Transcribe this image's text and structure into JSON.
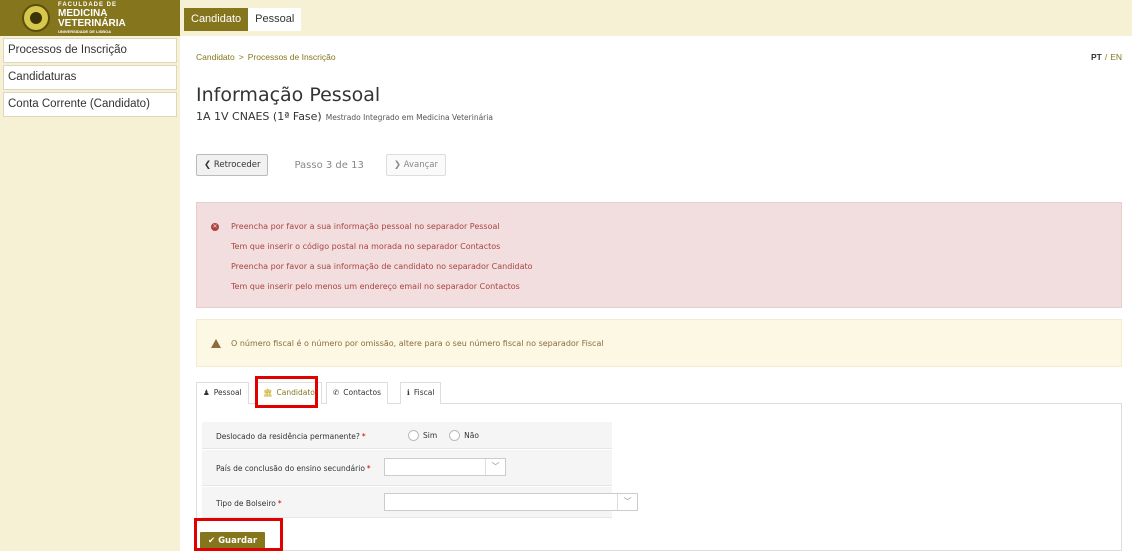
{
  "logo": {
    "line1": "FACULDADE DE",
    "line2": "MEDICINA",
    "line3": "VETERINÁRIA",
    "line4": "UNIVERSIDADE DE LISBOA"
  },
  "topnav": {
    "tabs": [
      {
        "label": "Candidato",
        "active": false
      },
      {
        "label": "Pessoal",
        "active": true
      }
    ]
  },
  "sidebar": {
    "items": [
      {
        "label": "Processos de Inscrição"
      },
      {
        "label": "Candidaturas"
      },
      {
        "label": "Conta Corrente (Candidato)"
      }
    ]
  },
  "breadcrumb": {
    "items": [
      "Candidato",
      "Processos de Inscrição"
    ],
    "separator": ">"
  },
  "language": {
    "pt": "PT",
    "separator": "/",
    "en": "EN"
  },
  "page": {
    "title": "Informação Pessoal",
    "subtitle_main": "1A 1V CNAES (1ª Fase)",
    "subtitle_small": "Mestrado Integrado em Medicina Veterinária"
  },
  "stepper": {
    "back_label": "❮ Retroceder",
    "step_text": "Passo 3 de 13",
    "next_label": "❯ Avançar"
  },
  "errors": [
    "Preencha por favor a sua informação pessoal no separador Pessoal",
    "Tem que inserir o código postal na morada no separador Contactos",
    "Preencha por favor a sua informação de candidato no separador Candidato",
    "Tem que inserir pelo menos um endereço email no separador Contactos"
  ],
  "warning": "O número fiscal é o número por omissão, altere para o seu número fiscal no separador Fiscal",
  "tabs": [
    {
      "label": "Pessoal",
      "icon": "user-icon",
      "glyph": "♟",
      "active": false
    },
    {
      "label": "Candidato",
      "icon": "institution-icon",
      "glyph": "🏛",
      "active": true
    },
    {
      "label": "Contactos",
      "icon": "phone-icon",
      "glyph": "✆",
      "active": false
    },
    {
      "label": "Fiscal",
      "icon": "info-icon",
      "glyph": "ℹ",
      "active": false
    }
  ],
  "form": {
    "relocated_label": "Deslocado da residência permanente?",
    "relocated_options": [
      "Sim",
      "Não"
    ],
    "country_label": "País de conclusão do ensino secundário",
    "country_value": "",
    "scholarship_label": "Tipo de Bolseiro",
    "scholarship_value": "",
    "required_mark": "*"
  },
  "save_label": "✔ Guardar",
  "colors": {
    "brand": "#85761d",
    "brand_light": "#f6f0d4",
    "error_bg": "#f2dede",
    "error_text": "#a94442",
    "warn_bg": "#fcf8e3",
    "warn_text": "#8a6d3b",
    "highlight": "#e00000"
  }
}
